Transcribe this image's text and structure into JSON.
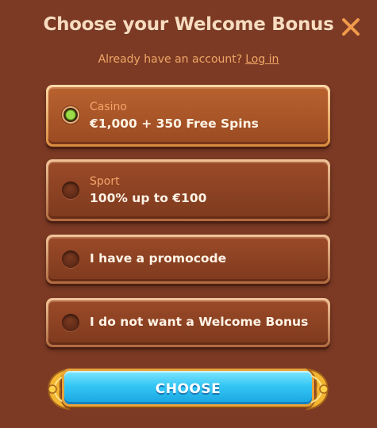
{
  "modal": {
    "title": "Choose your Welcome Bonus",
    "close_icon": "close-icon",
    "subtitle": {
      "text": "Already have an account?",
      "login_link": "Log in"
    }
  },
  "options": [
    {
      "category": "Casino",
      "label": "€1,000 + 350 Free Spins",
      "selected": true
    },
    {
      "category": "Sport",
      "label": "100% up to €100",
      "selected": false
    },
    {
      "category": "",
      "label": "I have a promocode",
      "selected": false
    },
    {
      "category": "",
      "label": "I do not want a Welcome Bonus",
      "selected": false
    }
  ],
  "choose_button": {
    "label": "CHOOSE"
  },
  "colors": {
    "background": "#7c3a24",
    "title": "#f7dcc0",
    "accent_orange": "#f0a667",
    "close": "#f19a4b",
    "button_blue": "#33c6f4",
    "radio_selected": "#8fd13a"
  }
}
